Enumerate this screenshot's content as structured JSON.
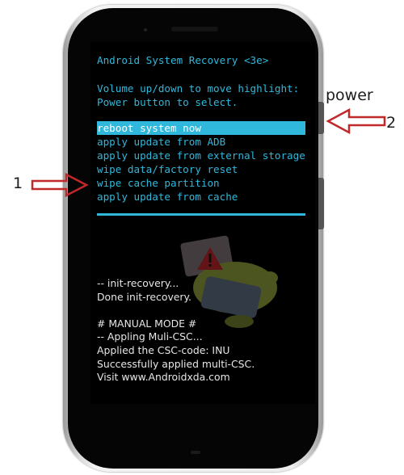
{
  "recovery": {
    "title": "Android System Recovery <3e>",
    "instructions": [
      "Volume up/down to move highlight:",
      "Power button to select."
    ],
    "menu": [
      {
        "label": "reboot system now",
        "selected": true
      },
      {
        "label": "apply update from ADB",
        "selected": false
      },
      {
        "label": "apply update from external storage",
        "selected": false
      },
      {
        "label": "wipe data/factory reset",
        "selected": false
      },
      {
        "label": "wipe cache partition",
        "selected": false
      },
      {
        "label": "apply update from cache",
        "selected": false
      }
    ],
    "log": [
      "-- init-recovery...",
      "Done init-recovery.",
      "",
      "# MANUAL MODE #",
      "-- Appling Muli-CSC...",
      "Applied the CSC-code: INU",
      "Successfully applied multi-CSC.",
      "Visit www.Androidxda.com"
    ]
  },
  "annotations": {
    "power_label": "power",
    "step_one": "1",
    "step_two": "2"
  },
  "colors": {
    "recovery_text": "#2fb8dc",
    "highlight_bg": "#2fb8dc",
    "log_text": "#e6e6e6",
    "annotation_arrow": "#c0282a"
  },
  "icons": {
    "background_art": "android-warning-icon",
    "arrows": "arrow-right-outline-icon"
  }
}
